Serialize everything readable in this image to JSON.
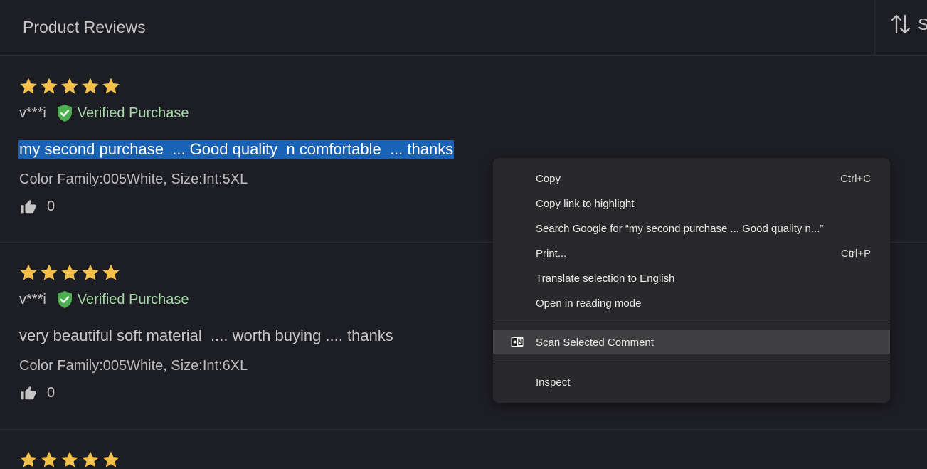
{
  "header": {
    "title": "Product Reviews",
    "sort_label": "Sort"
  },
  "colors": {
    "background": "#1d1d24",
    "star": "#f5c04a",
    "verified": "#4caf50",
    "selection": "#1a62b5",
    "menu_bg": "#29292b"
  },
  "reviews": [
    {
      "rating": 5,
      "reviewer": "v***i",
      "verified_label": "Verified Purchase",
      "comment": "my second purchase  ... Good quality  n comfortable  ... thanks",
      "variant": "Color Family:005White, Size:Int:5XL",
      "likes": "0",
      "selected": true
    },
    {
      "rating": 5,
      "reviewer": "v***i",
      "verified_label": "Verified Purchase",
      "comment": "very beautiful soft material  .... worth buying .... thanks",
      "variant": "Color Family:005White, Size:Int:6XL",
      "likes": "0",
      "selected": false
    },
    {
      "rating": 5
    }
  ],
  "context_menu": {
    "items": [
      {
        "label": "Copy",
        "shortcut": "Ctrl+C"
      },
      {
        "label": "Copy link to highlight",
        "shortcut": ""
      },
      {
        "label": "Search Google for “my second purchase  ... Good quality  n...”",
        "shortcut": ""
      },
      {
        "label": "Print...",
        "shortcut": "Ctrl+P"
      },
      {
        "label": "Translate selection to English",
        "shortcut": ""
      },
      {
        "label": "Open in reading mode",
        "shortcut": ""
      },
      {
        "label": "Scan Selected Comment",
        "shortcut": "",
        "icon": "extension-icon",
        "highlighted": true
      },
      {
        "label": "Inspect",
        "shortcut": ""
      }
    ]
  }
}
